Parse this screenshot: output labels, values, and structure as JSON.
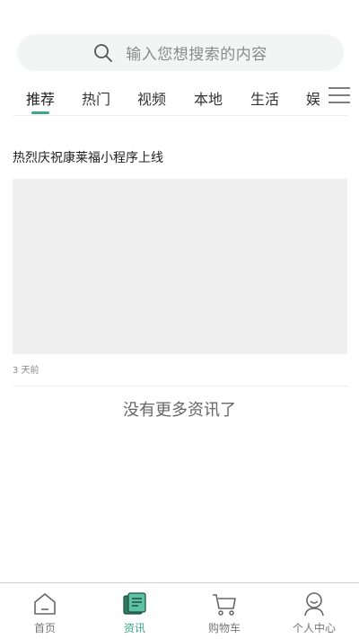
{
  "search": {
    "placeholder": "输入您想搜索的内容",
    "icon": "search-icon"
  },
  "tabs": [
    {
      "label": "推荐",
      "active": true
    },
    {
      "label": "热门"
    },
    {
      "label": "视频"
    },
    {
      "label": "本地"
    },
    {
      "label": "生活"
    },
    {
      "label": "娱"
    }
  ],
  "menu_icon": "hamburger-menu-icon",
  "news": [
    {
      "title": "热烈庆祝康莱福小程序上线",
      "time": "3 天前"
    }
  ],
  "end_text": "没有更多资讯了",
  "bottom_nav": [
    {
      "label": "首页",
      "icon": "home-icon"
    },
    {
      "label": "资讯",
      "icon": "news-icon",
      "active": true
    },
    {
      "label": "购物车",
      "icon": "cart-icon"
    },
    {
      "label": "个人中心",
      "icon": "profile-icon"
    }
  ],
  "colors": {
    "accent": "#3aa889",
    "search_bg": "#f3f5f4",
    "image_placeholder": "#efefef"
  }
}
